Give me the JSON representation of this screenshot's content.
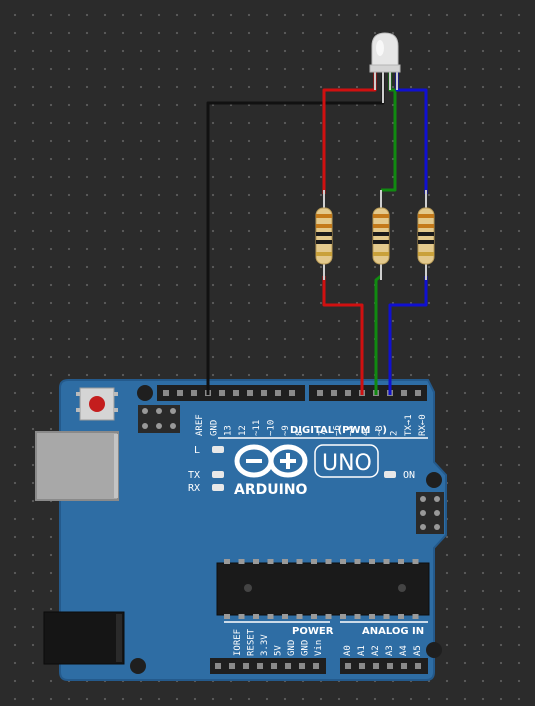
{
  "board": {
    "name": "UNO",
    "brand": "ARDUINO",
    "digital_label": "DIGITAL (PWM ~)",
    "power_label": "POWER",
    "analog_label": "ANALOG IN",
    "led_l": "L",
    "led_tx": "TX",
    "led_rx": "RX",
    "on_label": "ON",
    "top_left_pins": [
      "AREF",
      "GND",
      "13",
      "12",
      "~11",
      "~10",
      "~9",
      "8"
    ],
    "top_right_pins": [
      "7",
      "~6",
      "~5",
      "4",
      "~3",
      "2",
      "TX→1",
      "RX←0"
    ],
    "power_pins": [
      "IOREF",
      "RESET",
      "3.3V",
      "5V",
      "GND",
      "GND",
      "Vin"
    ],
    "analog_pins": [
      "A0",
      "A1",
      "A2",
      "A3",
      "A4",
      "A5"
    ]
  },
  "components": {
    "led": "rgb-led",
    "resistors": [
      "resistor-red",
      "resistor-green",
      "resistor-blue"
    ]
  },
  "wires": [
    {
      "name": "common-cathode-to-gnd",
      "color": "#111111",
      "pin": "GND"
    },
    {
      "name": "red-channel",
      "color": "#d01010",
      "pin": "~5"
    },
    {
      "name": "green-channel",
      "color": "#108a10",
      "pin": "~3"
    },
    {
      "name": "blue-channel",
      "color": "#1010d0",
      "pin": "2"
    }
  ],
  "colors": {
    "board": "#2e6da4",
    "board_edge": "#245a8c"
  }
}
